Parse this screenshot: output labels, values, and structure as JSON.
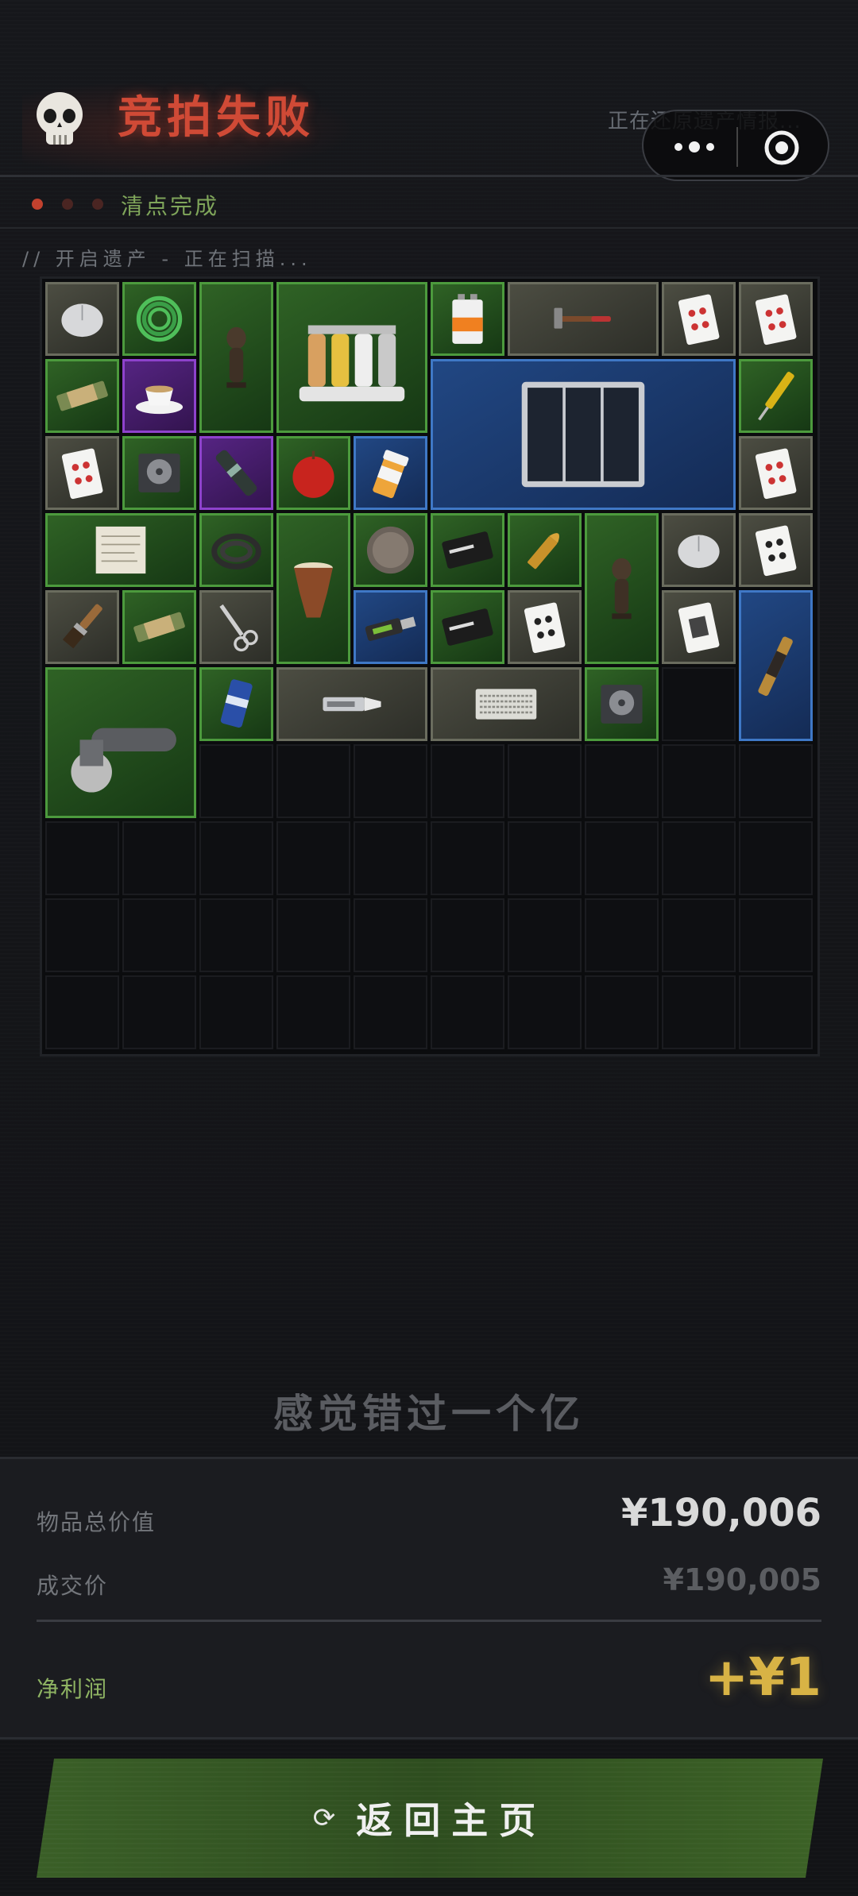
{
  "header": {
    "title": "竞拍失败",
    "status": "正在还原遗产情报...",
    "skull_icon": "skull-icon"
  },
  "capsule": {
    "more_icon": "more-icon",
    "close_icon": "target-icon"
  },
  "progress": {
    "label": "清点完成",
    "active_color": "#c2412e"
  },
  "scan_text": "// 开启遗产 - 正在扫描...",
  "inventory": {
    "cols": 10,
    "rows": 10,
    "items": [
      {
        "name": "computer-mouse",
        "icon": "mouse-icon",
        "rarity": "gray"
      },
      {
        "name": "green-cable",
        "icon": "cable-coil-icon",
        "rarity": "green"
      },
      {
        "name": "tribal-statue",
        "icon": "statue-icon",
        "rarity": "green"
      },
      {
        "name": "spice-rack",
        "icon": "spice-rack-icon",
        "rarity": "green"
      },
      {
        "name": "battery-9v",
        "icon": "battery-icon",
        "rarity": "green"
      },
      {
        "name": "hammer",
        "icon": "hammer-icon",
        "rarity": "gray"
      },
      {
        "name": "playing-card",
        "icon": "card-hearts-icon",
        "rarity": "gray"
      },
      {
        "name": "playing-card",
        "icon": "card-diamonds-icon",
        "rarity": "gray"
      },
      {
        "name": "snack-bar",
        "icon": "snack-bar-icon",
        "rarity": "green"
      },
      {
        "name": "teacup",
        "icon": "teacup-icon",
        "rarity": "purple"
      },
      {
        "name": "solar-panel",
        "icon": "solar-panel-icon",
        "rarity": "blue"
      },
      {
        "name": "screwdriver-tester",
        "icon": "tester-pen-icon",
        "rarity": "green"
      },
      {
        "name": "playing-card",
        "icon": "card-hearts-icon",
        "rarity": "gray"
      },
      {
        "name": "hard-drive",
        "icon": "hard-drive-icon",
        "rarity": "green"
      },
      {
        "name": "capacitor",
        "icon": "capacitor-icon",
        "rarity": "purple"
      },
      {
        "name": "apple",
        "icon": "apple-icon",
        "rarity": "green"
      },
      {
        "name": "pill-bottle",
        "icon": "pill-bottle-icon",
        "rarity": "blue"
      },
      {
        "name": "playing-card",
        "icon": "card-hearts-icon",
        "rarity": "gray"
      },
      {
        "name": "old-document",
        "icon": "paper-icon",
        "rarity": "green"
      },
      {
        "name": "hose-coil",
        "icon": "hose-icon",
        "rarity": "green"
      },
      {
        "name": "djembe-drum",
        "icon": "drum-icon",
        "rarity": "green"
      },
      {
        "name": "coin",
        "icon": "coin-icon",
        "rarity": "green"
      },
      {
        "name": "good-luck-card",
        "icon": "card-black-icon",
        "rarity": "green"
      },
      {
        "name": "bullet",
        "icon": "bullet-icon",
        "rarity": "green"
      },
      {
        "name": "tribal-statue",
        "icon": "statue-icon",
        "rarity": "green"
      },
      {
        "name": "computer-mouse",
        "icon": "mouse-icon",
        "rarity": "gray"
      },
      {
        "name": "playing-card",
        "icon": "card-clubs-icon",
        "rarity": "gray"
      },
      {
        "name": "paint-brush",
        "icon": "brush-icon",
        "rarity": "gray"
      },
      {
        "name": "snack-bar",
        "icon": "snack-bar-icon",
        "rarity": "green"
      },
      {
        "name": "scissors",
        "icon": "scissors-icon",
        "rarity": "gray"
      },
      {
        "name": "usb-stick",
        "icon": "usb-icon",
        "rarity": "blue"
      },
      {
        "name": "good-luck-card",
        "icon": "card-black-icon",
        "rarity": "green"
      },
      {
        "name": "playing-card",
        "icon": "card-spades-icon",
        "rarity": "gray"
      },
      {
        "name": "portrait-card",
        "icon": "card-portrait-icon",
        "rarity": "gray"
      },
      {
        "name": "telescope",
        "icon": "telescope-icon",
        "rarity": "blue"
      },
      {
        "name": "angle-grinder",
        "icon": "grinder-icon",
        "rarity": "green"
      },
      {
        "name": "can",
        "icon": "can-icon",
        "rarity": "green"
      },
      {
        "name": "utility-knife",
        "icon": "knife-icon",
        "rarity": "gray"
      },
      {
        "name": "keyboard",
        "icon": "keyboard-icon",
        "rarity": "gray"
      },
      {
        "name": "hard-drive",
        "icon": "hard-drive-icon",
        "rarity": "green"
      }
    ]
  },
  "tagline": "感觉错过一个亿",
  "summary": {
    "total_label": "物品总价值",
    "total_value": "¥190,006",
    "deal_label": "成交价",
    "deal_value": "¥190,005",
    "profit_label": "净利润",
    "profit_value": "+¥1"
  },
  "button": {
    "label": "返回主页",
    "icon": "refresh-icon",
    "icon_glyph": "⟳"
  }
}
